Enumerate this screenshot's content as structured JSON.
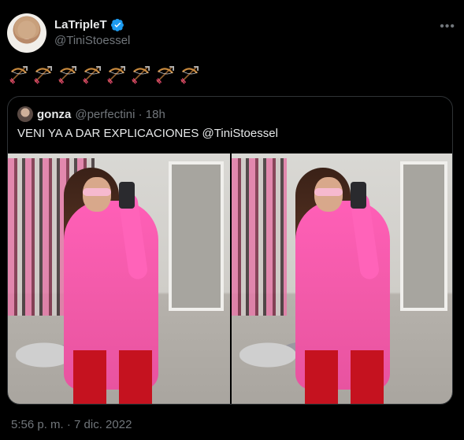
{
  "tweet": {
    "display_name": "LaTripleT",
    "handle": "@TiniStoessel",
    "emoji_count": 8,
    "timestamp": "5:56 p. m. · 7 dic. 2022",
    "icons": {
      "verified": "verified-badge-icon",
      "emoji": "bow-and-arrow-emoji-icon",
      "more": "more-options-icon"
    }
  },
  "quote": {
    "display_name": "gonza",
    "handle_time": "@perfectini · 18h",
    "text": "VENI YA A DAR EXPLICACIONES @TiniStoessel"
  },
  "colors": {
    "background": "#000000",
    "text_primary": "#e7e9ea",
    "text_secondary": "#71767b",
    "verified_blue": "#1d9bf0",
    "border": "#2f3336"
  }
}
